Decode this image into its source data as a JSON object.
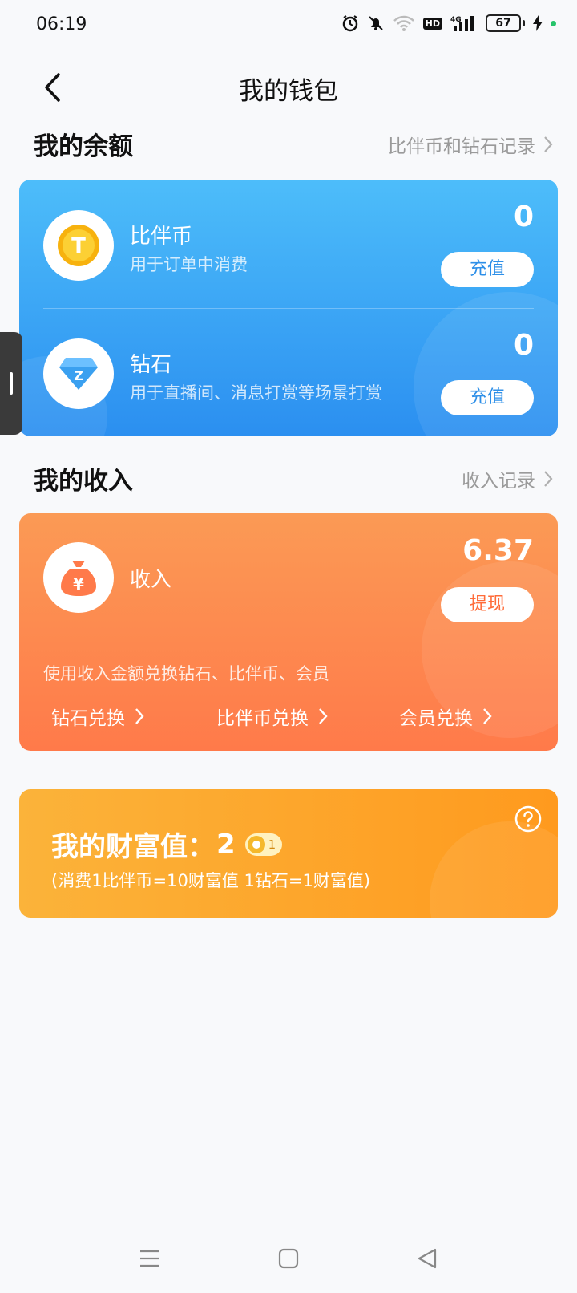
{
  "status_bar": {
    "time": "06:19",
    "battery": "67",
    "hd": "HD",
    "net": "4G"
  },
  "header": {
    "title": "我的钱包"
  },
  "balance_section": {
    "title": "我的余额",
    "link": "比伴币和钻石记录"
  },
  "balance": {
    "coin": {
      "name": "比伴币",
      "desc": "用于订单中消费",
      "value": "0",
      "action": "充值"
    },
    "diamond": {
      "name": "钻石",
      "desc": "用于直播间、消息打赏等场景打赏",
      "value": "0",
      "action": "充值"
    }
  },
  "income_section": {
    "title": "我的收入",
    "link": "收入记录"
  },
  "income": {
    "label": "收入",
    "value": "6.37",
    "action": "提现",
    "desc": "使用收入金额兑换钻石、比伴币、会员",
    "exchanges": [
      "钻石兑换",
      "比伴币兑换",
      "会员兑换"
    ]
  },
  "wealth": {
    "label": "我的财富值：",
    "value": "2",
    "level": "1",
    "note": "(消费1比伴币=10财富值 1钻石=1财富值)"
  },
  "colors": {
    "blue_card": "#2b8ff0",
    "orange_card": "#ff7a4a",
    "yellow_card": "#fbb33a"
  }
}
